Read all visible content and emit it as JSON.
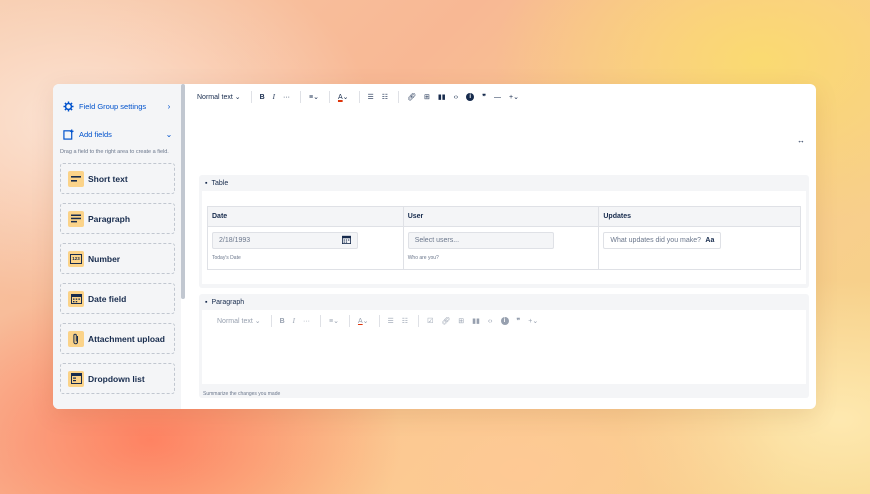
{
  "sidebar": {
    "settings_label": "Field Group settings",
    "add_fields_label": "Add fields",
    "hint": "Drag a field to the right area to create a field.",
    "items": [
      {
        "label": "Short text",
        "icon": "short-text-icon"
      },
      {
        "label": "Paragraph",
        "icon": "paragraph-icon"
      },
      {
        "label": "Number",
        "icon": "number-icon"
      },
      {
        "label": "Date field",
        "icon": "calendar-icon"
      },
      {
        "label": "Attachment upload",
        "icon": "paperclip-icon"
      },
      {
        "label": "Dropdown list",
        "icon": "dropdown-icon"
      }
    ]
  },
  "toolbar": {
    "text_style": "Normal text",
    "number_icon_text": "123"
  },
  "table_block": {
    "title": "Table",
    "headers": [
      "Date",
      "User",
      "Updates"
    ],
    "date_value": "2/18/1993",
    "date_hint": "Today's Date",
    "user_placeholder": "Select users...",
    "user_hint": "Who are you?",
    "updates_placeholder": "What updates did you make?",
    "updates_glyph": "Aa"
  },
  "paragraph_block": {
    "title": "Paragraph",
    "text_style": "Normal text",
    "footer_hint": "Summarize the changes you made"
  },
  "colors": {
    "accent": "#0052cc",
    "icon_bg": "#fbd389",
    "panel_bg": "#f4f5f7"
  }
}
